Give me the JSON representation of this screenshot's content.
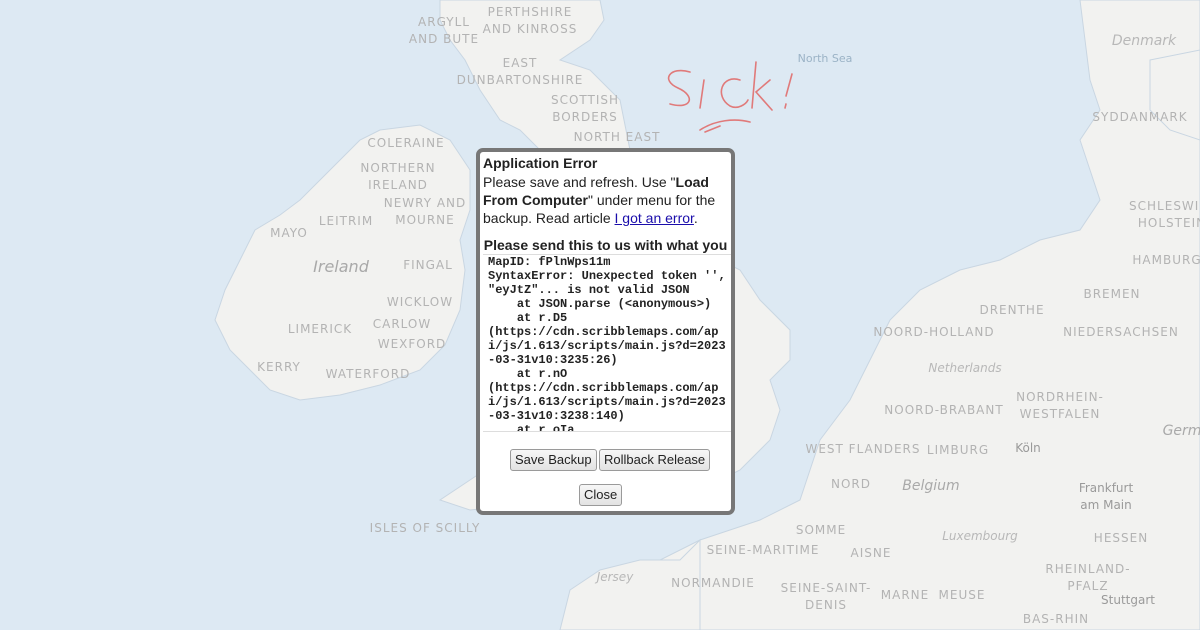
{
  "map": {
    "labels": {
      "argyll": "ARGYLL\nAND BUTE",
      "perthshire": "PERTHSHIRE\nAND KINROSS",
      "east_dunbarton": "EAST\nDUNBARTONSHIRE",
      "scottish_borders": "SCOTTISH\nBORDERS",
      "north_east": "NORTH EAST",
      "coleraine": "COLERAINE",
      "northern_ireland": "NORTHERN\nIRELAND",
      "newry": "NEWRY AND\nMOURNE",
      "leitrim": "LEITRIM",
      "mayo": "MAYO",
      "ireland": "Ireland",
      "fingal": "FINGAL",
      "wicklow": "WICKLOW",
      "limerick": "LIMERICK",
      "carlow": "CARLOW",
      "wexford": "WEXFORD",
      "kerry": "KERRY",
      "waterford": "WATERFORD",
      "isles_of_scilly": "ISLES OF SCILLY",
      "north_sea": "North Sea",
      "denmark": "Denmark",
      "syddanmark": "SYDDANMARK",
      "schleswig": "SCHLESWIG-\nHOLSTEIN",
      "hamburg": "HAMBURG",
      "bremen": "BREMEN",
      "drenthe": "DRENTHE",
      "noord_holland": "NOORD-HOLLAND",
      "niedersachsen": "NIEDERSACHSEN",
      "netherlands": "Netherlands",
      "noord_brabant": "NOORD-BRABANT",
      "nordrhein": "NORDRHEIN-\nWESTFALEN",
      "west_flanders": "WEST FLANDERS",
      "limburg": "LIMBURG",
      "koln": "Köln",
      "nord": "NORD",
      "belgium": "Belgium",
      "frankfurt": "Frankfurt\nam Main",
      "germany": "Germ",
      "luxembourg": "Luxembourg",
      "somme": "SOMME",
      "aisne": "AISNE",
      "hessen": "HESSEN",
      "seine_maritime": "SEINE-MARITIME",
      "rheinland": "RHEINLAND-\nPFALZ",
      "jersey": "Jersey",
      "normandie": "NORMANDIE",
      "seine_saint_denis": "SEINE-SAINT-\nDENIS",
      "marne": "MARNE",
      "meuse": "MEUSE",
      "stuttgart": "Stuttgart",
      "bas_rhin": "BAS-RHIN"
    },
    "doodle_text": "Sick!"
  },
  "dialog": {
    "title": "Application Error",
    "msg_pre": "Please save and refresh. Use \"",
    "msg_bold": "Load From Computer",
    "msg_post": "\" under menu for the backup. Read article ",
    "article_link": "I got an error",
    "msg_end": ".",
    "send_heading": "Please send this to us with what you",
    "log": "MapID: fPlnWps11m\nSyntaxError: Unexpected token '', \"eyJtZ\"... is not valid JSON\n    at JSON.parse (<anonymous>)\n    at r.D5\n(https://cdn.scribblemaps.com/api/js/1.613/scripts/main.js?d=2023-03-31v10:3235:26)\n    at r.nO\n(https://cdn.scribblemaps.com/api/js/1.613/scripts/main.js?d=2023-03-31v10:3238:140)\n    at r.oIa",
    "save_backup": "Save Backup",
    "rollback": "Rollback Release",
    "close": "Close"
  },
  "colors": {
    "sea": "#dbe9f4",
    "land": "#f2f2f0",
    "dialog_border": "#777777",
    "doodle": "#e07a7a"
  }
}
